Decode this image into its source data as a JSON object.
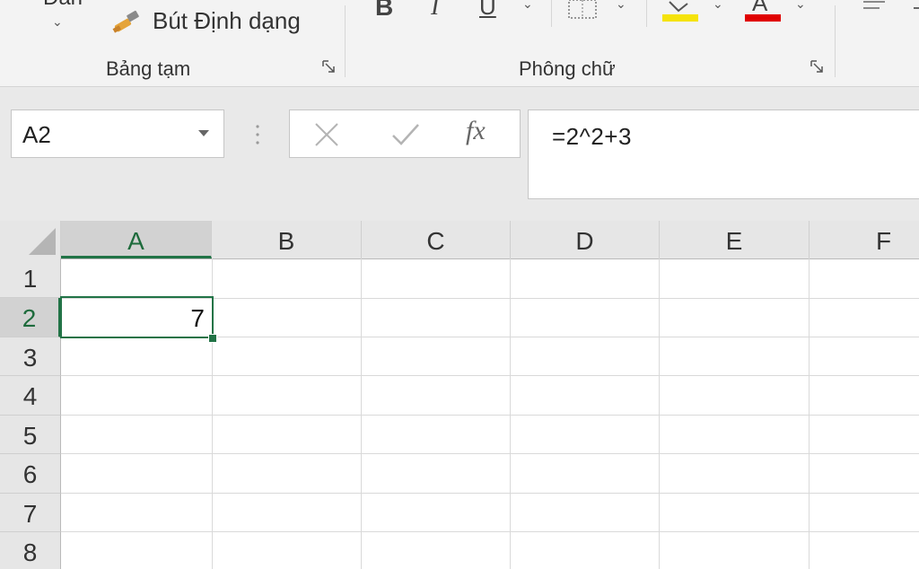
{
  "ribbon": {
    "clipboard": {
      "cut_partial": "Dán",
      "format_painter_label": "Bút Định dạng",
      "group_label": "Bảng tạm"
    },
    "font": {
      "group_label": "Phông chữ",
      "bold": "B",
      "italic": "I",
      "underline": "U",
      "font_color_glyph": "A",
      "highlight_color": "#f5e30a",
      "font_color": "#e00000"
    },
    "icons": [
      "format-painter-icon",
      "bold-icon",
      "italic-icon",
      "underline-icon",
      "borders-icon",
      "fill-color-icon",
      "font-color-icon",
      "align-icon",
      "dialog-launcher-icon"
    ]
  },
  "formula_bar": {
    "name_box": "A2",
    "fx_label": "fx",
    "formula": "=2^2+3"
  },
  "grid": {
    "columns": [
      "A",
      "B",
      "C",
      "D",
      "E",
      "F"
    ],
    "rows": [
      "1",
      "2",
      "3",
      "4",
      "5",
      "6",
      "7",
      "8"
    ],
    "selected_cell": "A2",
    "cells": {
      "A2": "7"
    }
  },
  "colors": {
    "accent": "#217346"
  }
}
